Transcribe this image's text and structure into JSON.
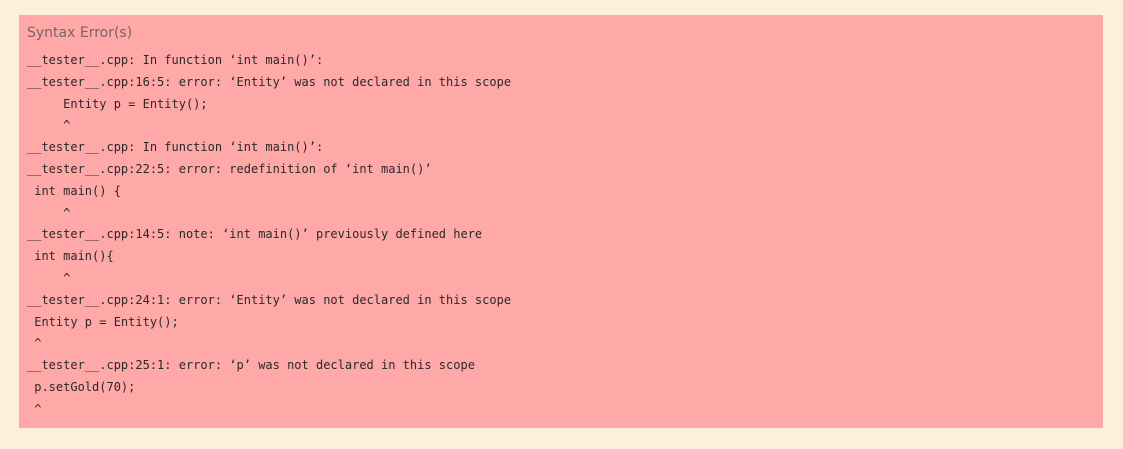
{
  "panel": {
    "title": "Syntax Error(s)",
    "background_color": "#ffa8a8",
    "page_background_color": "#fcefdc",
    "lines": [
      "__tester__.cpp: In function ‘int main()’:",
      "__tester__.cpp:16:5: error: ‘Entity’ was not declared in this scope",
      "     Entity p = Entity();",
      "     ^",
      "__tester__.cpp: In function ‘int main()’:",
      "__tester__.cpp:22:5: error: redefinition of ‘int main()’",
      " int main() {",
      "     ^",
      "__tester__.cpp:14:5: note: ‘int main()’ previously defined here",
      " int main(){",
      "     ^",
      "__tester__.cpp:24:1: error: ‘Entity’ was not declared in this scope",
      " Entity p = Entity();",
      " ^",
      "__tester__.cpp:25:1: error: ‘p’ was not declared in this scope",
      " p.setGold(70);",
      " ^"
    ]
  }
}
